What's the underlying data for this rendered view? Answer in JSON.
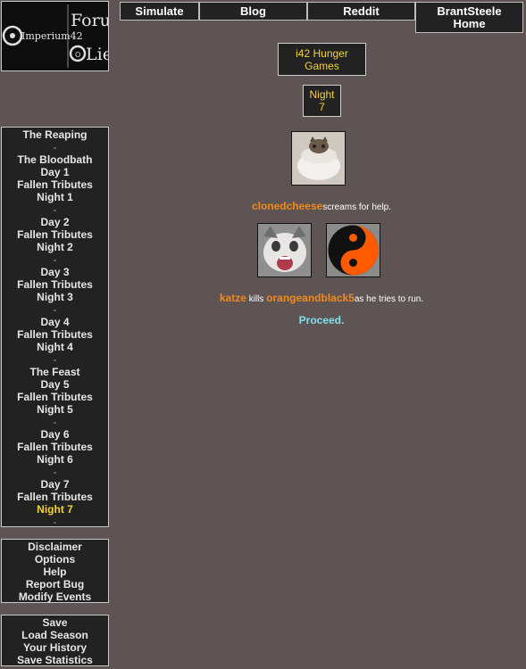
{
  "logo": {
    "left_text": "Imperium42",
    "right_top": "Forum",
    "right_bottom": "Lies",
    "right_ring": "O"
  },
  "nav": {
    "simulate": "Simulate",
    "blog": "Blog",
    "reddit": "Reddit",
    "home_line1": "BrantSteele",
    "home_line2": "Home"
  },
  "header": {
    "game_title": "i42 Hunger Games",
    "phase": "Night 7"
  },
  "sidebar": {
    "phases": [
      "The Reaping",
      "-",
      "The Bloodbath",
      "Day 1",
      "Fallen Tributes",
      "Night 1",
      "-",
      "Day 2",
      "Fallen Tributes",
      "Night 2",
      "-",
      "Day 3",
      "Fallen Tributes",
      "Night 3",
      "-",
      "Day 4",
      "Fallen Tributes",
      "Night 4",
      "-",
      "The Feast",
      "Day 5",
      "Fallen Tributes",
      "Night 5",
      "-",
      "Day 6",
      "Fallen Tributes",
      "Night 6",
      "-",
      "Day 7",
      "Fallen Tributes",
      "Night 7",
      "-"
    ],
    "active": "Night 7",
    "options": [
      "Disclaimer",
      "Options",
      "Help",
      "Report Bug",
      "Modify Events"
    ],
    "data": [
      "Save",
      "Load Season",
      "Your History",
      "Save Statistics"
    ]
  },
  "events": [
    {
      "tribute": "clonedcheese",
      "text": "screams for help."
    },
    {
      "tribute1": "katze",
      "mid": "kills",
      "tribute2": "orangeandblack5",
      "text": "as he tries to run."
    }
  ],
  "proceed": "Proceed.",
  "colors": {
    "background": "#5f5454",
    "panel": "#222222",
    "gold": "#f3d23a",
    "orange": "#f08a1c",
    "cyan": "#7fe0ea"
  }
}
